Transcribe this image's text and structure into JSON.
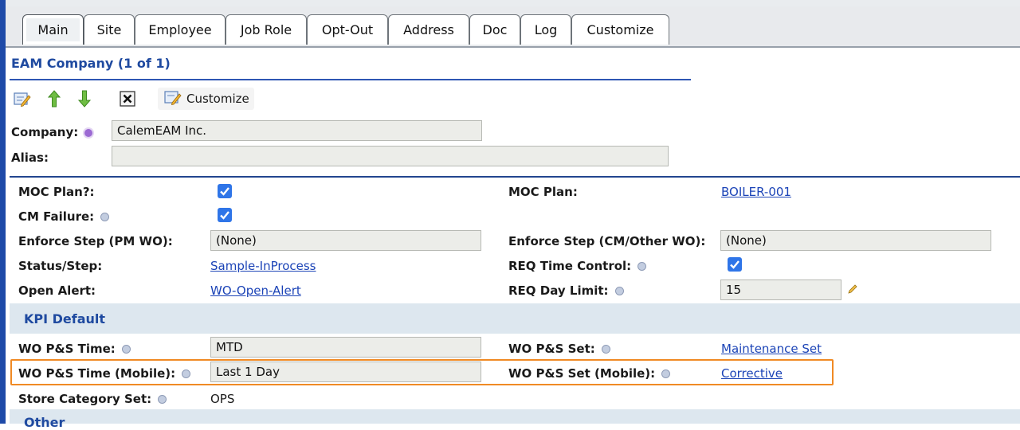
{
  "tabs": [
    {
      "label": "Main",
      "active": true
    },
    {
      "label": "Site"
    },
    {
      "label": "Employee"
    },
    {
      "label": "Job Role"
    },
    {
      "label": "Opt-Out"
    },
    {
      "label": "Address"
    },
    {
      "label": "Doc"
    },
    {
      "label": "Log"
    },
    {
      "label": "Customize"
    }
  ],
  "section": {
    "title": "EAM Company (1 of 1)"
  },
  "toolbar": {
    "icons": [
      "edit-icon",
      "arrow-up-icon",
      "arrow-down-icon",
      "close-icon",
      "customize-icon"
    ],
    "customize_label": "Customize"
  },
  "company": {
    "label": "Company:",
    "value": "CalemEAM Inc."
  },
  "alias": {
    "label": "Alias:",
    "value": ""
  },
  "fields": {
    "moc_plan_q": {
      "label": "MOC Plan?:",
      "checked": true
    },
    "moc_plan": {
      "label": "MOC Plan:",
      "value": "BOILER-001"
    },
    "cm_failure": {
      "label": "CM Failure:",
      "checked": true
    },
    "enforce_pm": {
      "label": "Enforce Step (PM WO):",
      "value": "(None)"
    },
    "enforce_cm": {
      "label": "Enforce Step (CM/Other WO):",
      "value": "(None)"
    },
    "status_step": {
      "label": "Status/Step:",
      "value": "Sample-InProcess"
    },
    "req_time": {
      "label": "REQ Time Control:",
      "checked": true
    },
    "open_alert": {
      "label": "Open Alert:",
      "value": "WO-Open-Alert"
    },
    "req_day": {
      "label": "REQ Day Limit:",
      "value": "15"
    }
  },
  "kpi": {
    "title": "KPI Default",
    "wo_ps_time": {
      "label": "WO P&S Time:",
      "value": "MTD"
    },
    "wo_ps_set": {
      "label": "WO P&S Set:",
      "value": "Maintenance Set"
    },
    "wo_ps_time_mobile": {
      "label": "WO P&S Time (Mobile):",
      "value": "Last 1 Day"
    },
    "wo_ps_set_mobile": {
      "label": "WO P&S Set (Mobile):",
      "value": "Corrective"
    },
    "store_category": {
      "label": "Store Category Set:",
      "value": "OPS"
    }
  },
  "other": {
    "title": "Other"
  },
  "colors": {
    "accent": "#1f4aa0",
    "link": "#1c44b7",
    "highlight": "#f08a24",
    "check": "#2f75e8"
  }
}
